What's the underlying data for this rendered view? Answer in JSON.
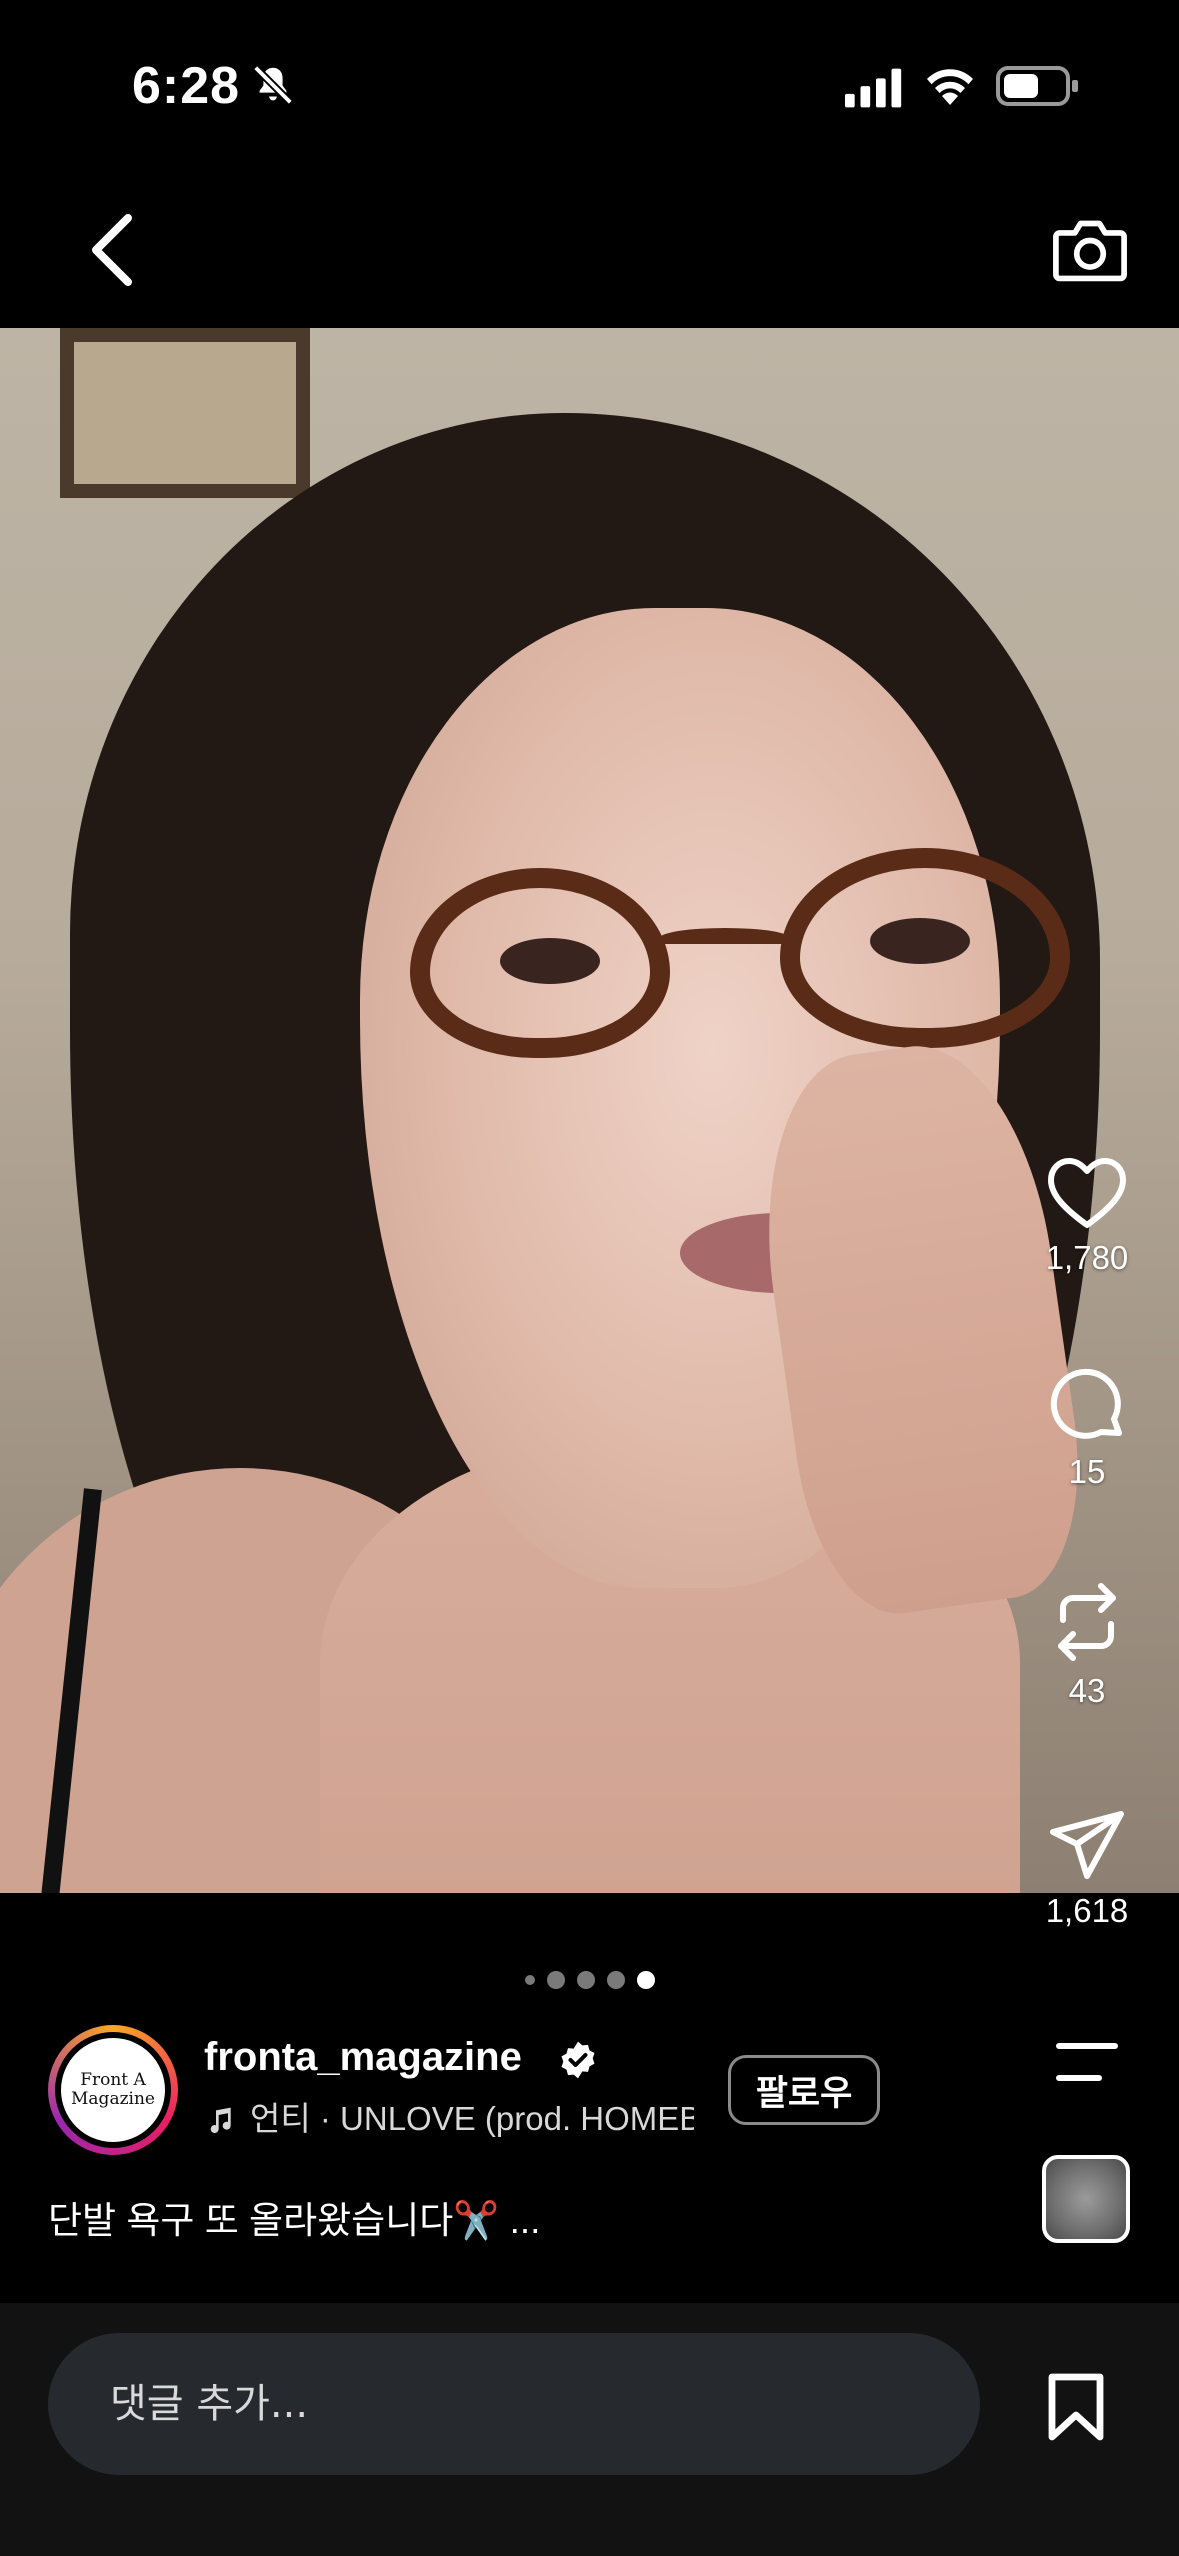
{
  "status_bar": {
    "time": "6:28"
  },
  "post": {
    "like_count": "1,780",
    "comment_count": "15",
    "repost_count": "43",
    "share_count": "1,618",
    "carousel": {
      "total": 5,
      "active_index": 4
    },
    "author": {
      "username": "fronta_magazine",
      "avatar_text": "Front A Magazine",
      "music": "언티 · UNLOVE (prod. HOMEBOY)"
    },
    "follow_label": "팔로우",
    "caption": "단발 욕구 또 올라왔습니다✂️  ..."
  },
  "comment_bar": {
    "placeholder": "댓글 추가..."
  }
}
